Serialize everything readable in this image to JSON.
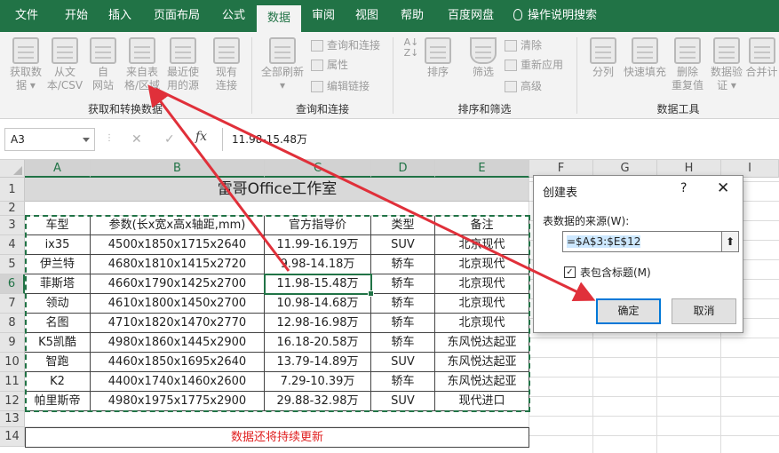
{
  "menu": {
    "tabs": [
      "文件",
      "开始",
      "插入",
      "页面布局",
      "公式",
      "数据",
      "审阅",
      "视图",
      "帮助",
      "百度网盘"
    ],
    "active_tab": "数据",
    "tell_me": "操作说明搜索"
  },
  "ribbon": {
    "get_transform": {
      "buttons": [
        {
          "label1": "获取数",
          "label2": "据 ▾"
        },
        {
          "label1": "从文",
          "label2": "本/CSV"
        },
        {
          "label1": "自",
          "label2": "网站"
        },
        {
          "label1": "来自表",
          "label2": "格/区域"
        },
        {
          "label1": "最近使",
          "label2": "用的源"
        },
        {
          "label1": "现有",
          "label2": "连接"
        }
      ],
      "group_label": "获取和转换数据"
    },
    "queries": {
      "refresh_label1": "全部刷新",
      "refresh_label2": "▾",
      "items": [
        "查询和连接",
        "属性",
        "编辑链接"
      ],
      "group_label": "查询和连接"
    },
    "sort_filter": {
      "sort_label": "排序",
      "filter_label": "筛选",
      "items": [
        "清除",
        "重新应用",
        "高级"
      ],
      "group_label": "排序和筛选"
    },
    "tools": {
      "buttons": [
        {
          "label1": "分列",
          "label2": ""
        },
        {
          "label1": "快速填充",
          "label2": ""
        },
        {
          "label1": "删除",
          "label2": "重复值"
        },
        {
          "label1": "数据验",
          "label2": "证 ▾"
        },
        {
          "label1": "合并计",
          "label2": ""
        }
      ],
      "group_label": "数据工具"
    }
  },
  "formula_bar": {
    "name_box": "A3",
    "fx": "fx",
    "value": "11.98-15.48万"
  },
  "sheet": {
    "columns": [
      "A",
      "B",
      "C",
      "D",
      "E",
      "F",
      "G",
      "H",
      "I"
    ],
    "rows": [
      "1",
      "2",
      "3",
      "4",
      "5",
      "6",
      "7",
      "8",
      "9",
      "10",
      "11",
      "12",
      "13",
      "14"
    ],
    "title": "雷哥Office工作室",
    "headers": [
      "车型",
      "参数(长x宽x高x轴距,mm)",
      "官方指导价",
      "类型",
      "备注"
    ],
    "data": [
      [
        "ix35",
        "4500x1850x1715x2640",
        "11.99-16.19万",
        "SUV",
        "北京现代"
      ],
      [
        "伊兰特",
        "4680x1810x1415x2720",
        "9.98-14.18万",
        "轿车",
        "北京现代"
      ],
      [
        "菲斯塔",
        "4660x1790x1425x2700",
        "11.98-15.48万",
        "轿车",
        "北京现代"
      ],
      [
        "领动",
        "4610x1800x1450x2700",
        "10.98-14.68万",
        "轿车",
        "北京现代"
      ],
      [
        "名图",
        "4710x1820x1470x2770",
        "12.98-16.98万",
        "轿车",
        "北京现代"
      ],
      [
        "K5凯酷",
        "4980x1860x1445x2900",
        "16.18-20.58万",
        "轿车",
        "东风悦达起亚"
      ],
      [
        "智跑",
        "4460x1850x1695x2640",
        "13.79-14.89万",
        "SUV",
        "东风悦达起亚"
      ],
      [
        "K2",
        "4400x1740x1460x2600",
        "7.29-10.39万",
        "轿车",
        "东风悦达起亚"
      ],
      [
        "帕里斯帝",
        "4980x1975x1775x2900",
        "29.88-32.98万",
        "SUV",
        "现代进口"
      ]
    ],
    "note": "数据还将持续更新"
  },
  "dialog": {
    "title": "创建表",
    "help": "?",
    "close": "✕",
    "source_label": "表数据的来源(W):",
    "source_value": "=$A$3:$E$12",
    "has_headers_label": "表包含标题(M)",
    "has_headers_checked": true,
    "ok": "确定",
    "cancel": "取消"
  },
  "colors": {
    "excel_green": "#217346",
    "arrow_red": "#e0303a",
    "note_red": "#e02020"
  }
}
